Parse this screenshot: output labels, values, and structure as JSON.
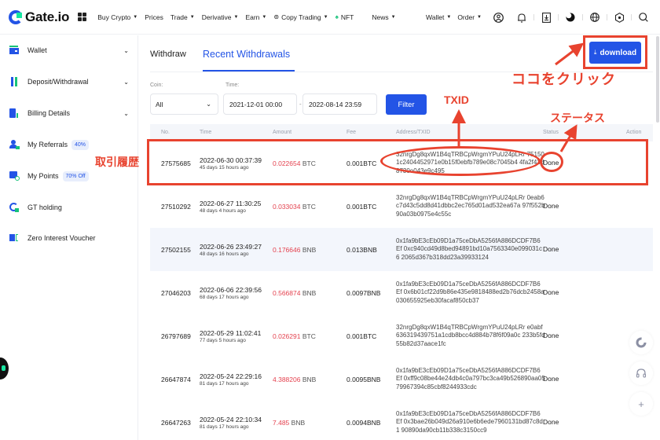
{
  "topnav": {
    "logo": "Gate.io",
    "items": [
      {
        "label": "Buy Crypto",
        "caret": true
      },
      {
        "label": "Prices",
        "caret": false
      },
      {
        "label": "Trade",
        "caret": true
      },
      {
        "label": "Derivative",
        "caret": true
      },
      {
        "label": "Earn",
        "caret": true
      },
      {
        "label": "Copy Trading",
        "caret": true,
        "icon": "copy-trading-icon"
      },
      {
        "label": "NFT",
        "caret": false,
        "icon": "nft-icon"
      },
      {
        "label": "News",
        "caret": true
      }
    ],
    "right_items": [
      {
        "label": "Wallet"
      },
      {
        "label": "Order"
      }
    ],
    "icons": [
      "user-icon",
      "bell-icon",
      "download-app-icon",
      "theme-icon",
      "globe-icon",
      "settings-icon",
      "search-icon"
    ],
    "caret": "▾"
  },
  "sidebar": {
    "items": [
      {
        "label": "Wallet",
        "icon": "wallet-icon",
        "chevron": true
      },
      {
        "label": "Deposit/Withdrawal",
        "icon": "deposit-withdrawal-icon",
        "chevron": true
      },
      {
        "label": "Billing Details",
        "icon": "billing-icon",
        "chevron": true
      },
      {
        "label": "My Referrals",
        "icon": "referrals-icon",
        "badge": "40%"
      },
      {
        "label": "My Points",
        "icon": "points-icon",
        "badge": "70% Off"
      },
      {
        "label": "GT holding",
        "icon": "gt-icon"
      },
      {
        "label": "Zero Interest Voucher",
        "icon": "voucher-icon"
      }
    ],
    "chevron_glyph": "⌄"
  },
  "main": {
    "tabs": [
      {
        "label": "Withdraw",
        "active": false
      },
      {
        "label": "Recent Withdrawals",
        "active": true
      }
    ],
    "download_label": "download",
    "download_icon": "⤓",
    "filters": {
      "coin_label": "Coin:",
      "coin_value": "All",
      "time_label": "Time:",
      "start": "2021-12-01 00:00",
      "dash": "-",
      "end": "2022-08-14 23:59",
      "filter_label": "Filter"
    },
    "table": {
      "headers": [
        "No.",
        "Time",
        "Amount",
        "Fee",
        "Address/TXID",
        "Status",
        "Action"
      ],
      "rows": [
        {
          "no": "27575685",
          "time": "2022-06-30 00:37:39",
          "ago": "45 days 15 hours ago",
          "amount": "0.022654",
          "coin": "BTC",
          "fee": "0.001BTC",
          "address": "32nrgDg8qxW1B4qTRBCpWrgmYPuU24pLRr 751501c2404452971e0b15f0ebfb789e08c7045b4 4fa2f43d8730e043e9c495",
          "status": "Done"
        },
        {
          "no": "27510292",
          "time": "2022-06-27 11:30:25",
          "ago": "48 days 4 hours ago",
          "amount": "0.033034",
          "coin": "BTC",
          "fee": "0.001BTC",
          "address": "32nrgDg8qxW1B4qTRBCpWrgmYPuU24pLRr 0eab6c7d43c5dd8d41dbbc2ec765d01ad532ea67a 97f552b90a03b0975e4c55c",
          "status": "Done"
        },
        {
          "no": "27502155",
          "time": "2022-06-26 23:49:27",
          "ago": "48 days 16 hours ago",
          "amount": "0.176646",
          "coin": "BNB",
          "fee": "0.013BNB",
          "address": "0x1fa9bE3cEb09D1a75ceDbA5256fA886DCDF7B6 Ef 0xc940cd49d8bed94891bd10a7563340e099031c6 2065d367b318dd23a39933124",
          "status": "Done"
        },
        {
          "no": "27046203",
          "time": "2022-06-06 22:39:56",
          "ago": "68 days 17 hours ago",
          "amount": "0.566874",
          "coin": "BNB",
          "fee": "0.0097BNB",
          "address": "0x1fa9bE3cEb09D1a75ceDbA5256fA886DCDF7B6 Ef 0x6b01cf22d9b86e435e9818488ed2b76dcb2458a 030655925eb30facaf850cb37",
          "status": "Done"
        },
        {
          "no": "26797689",
          "time": "2022-05-29 11:02:41",
          "ago": "77 days 5 hours ago",
          "amount": "0.026291",
          "coin": "BTC",
          "fee": "0.001BTC",
          "address": "32nrgDg8qxW1B4qTRBCpWrgmYPuU24pLRr e0abf636319439751a1cdb8bcc4d884b78f6f09a0c 233b5fd55b82d37aace1fc",
          "status": "Done"
        },
        {
          "no": "26647874",
          "time": "2022-05-24 22:29:16",
          "ago": "81 days 17 hours ago",
          "amount": "4.388206",
          "coin": "BNB",
          "fee": "0.0095BNB",
          "address": "0x1fa9bE3cEb09D1a75ceDbA5256fA886DCDF7B6 Ef 0xff9c08be44e24db4c0a797bc3ca49b526890aa05 79967394c85cbf8244933cdc",
          "status": "Done"
        },
        {
          "no": "26647263",
          "time": "2022-05-24 22:10:34",
          "ago": "81 days 17 hours ago",
          "amount": "7.485",
          "coin": "BNB",
          "fee": "0.0094BNB",
          "address": "0x1fa9bE3cEb09D1a75ceDbA5256fA886DCDF7B6 Ef 0x3bae26b049d26a910e6b6ede7960131bd87c8d1 90890da90cb11b338c3150cc9",
          "status": "Done"
        }
      ]
    }
  },
  "annotations": {
    "click_here": "ココをクリック",
    "txid": "TXID",
    "status": "ステータス",
    "history": "取引履歴",
    "color": "#e8432f"
  },
  "floating": {
    "icons": [
      "refresh-icon",
      "headset-icon",
      "plus-icon"
    ],
    "glyphs": [
      "↻",
      "🎧",
      "+"
    ]
  },
  "colors": {
    "brand_blue": "#2354e6",
    "amount_red": "#e4424f",
    "accent_green": "#17e6a1"
  }
}
